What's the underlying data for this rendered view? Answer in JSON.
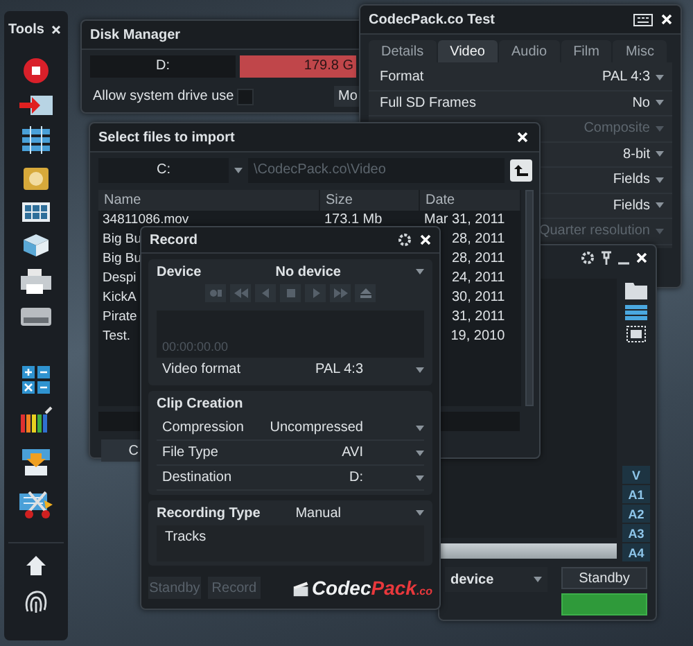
{
  "tools": {
    "title": "Tools"
  },
  "disk_manager": {
    "title": "Disk Manager",
    "drive": "D:",
    "free_space": "179.8 G",
    "allow_system_drive": {
      "label": "Allow system drive use",
      "checked": false
    },
    "button": "Mo"
  },
  "codec_test": {
    "title": "CodecPack.co Test",
    "tabs": [
      {
        "label": "Details",
        "selected": false
      },
      {
        "label": "Video",
        "selected": true
      },
      {
        "label": "Audio",
        "selected": false
      },
      {
        "label": "Film",
        "selected": false
      },
      {
        "label": "Misc",
        "selected": false
      }
    ],
    "settings": [
      {
        "label": "Format",
        "value": "PAL 4:3",
        "disabled": false
      },
      {
        "label": "Full SD Frames",
        "value": "No",
        "disabled": false
      },
      {
        "value": "Composite",
        "disabled": true
      },
      {
        "value": "8-bit",
        "disabled": false
      },
      {
        "value": "Fields",
        "disabled": false
      },
      {
        "value": "Fields",
        "disabled": false
      },
      {
        "value": "Quarter resolution",
        "disabled": true
      }
    ]
  },
  "capture": {
    "tracks": [
      "V",
      "A1",
      "A2",
      "A3",
      "A4"
    ],
    "device": "device",
    "button": "Standby"
  },
  "import_dialog": {
    "title": "Select files to import",
    "drive": "C:",
    "path": "\\CodecPack.co\\Video",
    "columns": [
      "Name",
      "Size",
      "Date"
    ],
    "rows": [
      {
        "name": "34811086.mov",
        "size": "173.1 Mb",
        "date": "Mar 31, 2011"
      },
      {
        "name": "Big Bu",
        "date": "28, 2011"
      },
      {
        "name": "Big Bu",
        "date": "28, 2011"
      },
      {
        "name": "Despi",
        "date": "24, 2011"
      },
      {
        "name": "KickA",
        "date": "30, 2011"
      },
      {
        "name": "Pirate",
        "date": "31, 2011"
      },
      {
        "name": "Test.",
        "date": "19, 2010"
      }
    ],
    "button": "C"
  },
  "record": {
    "title": "Record",
    "device_label": "Device",
    "device": "No device",
    "timecode": "00:00:00.00",
    "video_format": {
      "label": "Video format",
      "value": "PAL 4:3"
    },
    "clip_title": "Clip Creation",
    "clip_rows": [
      {
        "label": "Compression",
        "value": "Uncompressed"
      },
      {
        "label": "File Type",
        "value": "AVI"
      },
      {
        "label": "Destination",
        "value": "D:"
      }
    ],
    "recording_type": {
      "label": "Recording Type",
      "value": "Manual"
    },
    "tracks_label": "Tracks",
    "buttons": [
      {
        "label": "Standby",
        "disabled": true
      },
      {
        "label": "Record",
        "disabled": true
      }
    ],
    "logo": {
      "first": "Codec",
      "second": "Pack",
      "suffix": ".co"
    }
  }
}
